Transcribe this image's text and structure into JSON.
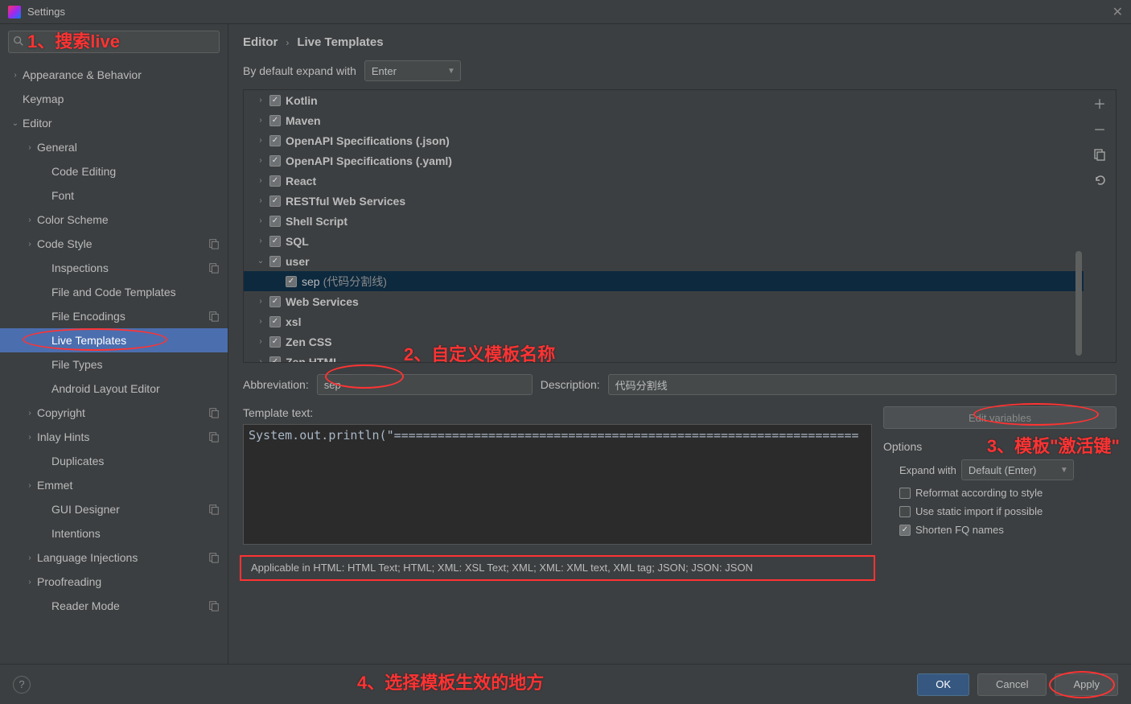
{
  "window": {
    "title": "Settings"
  },
  "search": {
    "placeholder": ""
  },
  "annotations": {
    "a1": "1、搜索live",
    "a2": "2、自定义模板名称",
    "a3": "3、模板\"激活键\"",
    "a4": "4、选择模板生效的地方"
  },
  "sidebar": [
    {
      "label": "Appearance & Behavior",
      "arrow": "›",
      "indent": 0
    },
    {
      "label": "Keymap",
      "arrow": "",
      "indent": 0
    },
    {
      "label": "Editor",
      "arrow": "⌄",
      "indent": 0
    },
    {
      "label": "General",
      "arrow": "›",
      "indent": 1
    },
    {
      "label": "Code Editing",
      "arrow": "",
      "indent": 2
    },
    {
      "label": "Font",
      "arrow": "",
      "indent": 2
    },
    {
      "label": "Color Scheme",
      "arrow": "›",
      "indent": 1
    },
    {
      "label": "Code Style",
      "arrow": "›",
      "indent": 1,
      "badge": true
    },
    {
      "label": "Inspections",
      "arrow": "",
      "indent": 2,
      "badge": true
    },
    {
      "label": "File and Code Templates",
      "arrow": "",
      "indent": 2
    },
    {
      "label": "File Encodings",
      "arrow": "",
      "indent": 2,
      "badge": true
    },
    {
      "label": "Live Templates",
      "arrow": "",
      "indent": 2,
      "selected": true
    },
    {
      "label": "File Types",
      "arrow": "",
      "indent": 2
    },
    {
      "label": "Android Layout Editor",
      "arrow": "",
      "indent": 2
    },
    {
      "label": "Copyright",
      "arrow": "›",
      "indent": 1,
      "badge": true
    },
    {
      "label": "Inlay Hints",
      "arrow": "›",
      "indent": 1,
      "badge": true
    },
    {
      "label": "Duplicates",
      "arrow": "",
      "indent": 2
    },
    {
      "label": "Emmet",
      "arrow": "›",
      "indent": 1
    },
    {
      "label": "GUI Designer",
      "arrow": "",
      "indent": 2,
      "badge": true
    },
    {
      "label": "Intentions",
      "arrow": "",
      "indent": 2
    },
    {
      "label": "Language Injections",
      "arrow": "›",
      "indent": 1,
      "badge": true
    },
    {
      "label": "Proofreading",
      "arrow": "›",
      "indent": 1
    },
    {
      "label": "Reader Mode",
      "arrow": "",
      "indent": 2,
      "badge": true
    }
  ],
  "breadcrumb": {
    "root": "Editor",
    "leaf": "Live Templates"
  },
  "expand": {
    "label": "By default expand with",
    "value": "Enter"
  },
  "templates": [
    {
      "name": "Kotlin",
      "arrow": "›",
      "checked": true
    },
    {
      "name": "Maven",
      "arrow": "›",
      "checked": true
    },
    {
      "name": "OpenAPI Specifications (.json)",
      "arrow": "›",
      "checked": true
    },
    {
      "name": "OpenAPI Specifications (.yaml)",
      "arrow": "›",
      "checked": true
    },
    {
      "name": "React",
      "arrow": "›",
      "checked": true
    },
    {
      "name": "RESTful Web Services",
      "arrow": "›",
      "checked": true
    },
    {
      "name": "Shell Script",
      "arrow": "›",
      "checked": true
    },
    {
      "name": "SQL",
      "arrow": "›",
      "checked": true
    },
    {
      "name": "user",
      "arrow": "⌄",
      "checked": true
    },
    {
      "name": "sep",
      "desc": "(代码分割线)",
      "checked": true,
      "child": true,
      "selected": true
    },
    {
      "name": "Web Services",
      "arrow": "›",
      "checked": true
    },
    {
      "name": "xsl",
      "arrow": "›",
      "checked": true
    },
    {
      "name": "Zen CSS",
      "arrow": "›",
      "checked": true
    },
    {
      "name": "Zen HTML",
      "arrow": "›",
      "checked": true
    }
  ],
  "form": {
    "abbr_label": "Abbreviation:",
    "abbr_value": "sep",
    "desc_label": "Description:",
    "desc_value": "代码分割线",
    "tmpl_label": "Template text:",
    "tmpl_value": "System.out.println(\"================================================================",
    "edit_vars": "Edit variables",
    "options": "Options",
    "expand_label": "Expand with",
    "expand_value": "Default (Enter)",
    "cb_reformat": "Reformat according to style",
    "cb_static": "Use static import if possible",
    "cb_shorten": "Shorten FQ names",
    "applicable": "Applicable in HTML: HTML Text; HTML; XML: XSL Text; XML; XML: XML text, XML tag; JSON; JSON: JSON"
  },
  "footer": {
    "ok": "OK",
    "cancel": "Cancel",
    "apply": "Apply"
  }
}
